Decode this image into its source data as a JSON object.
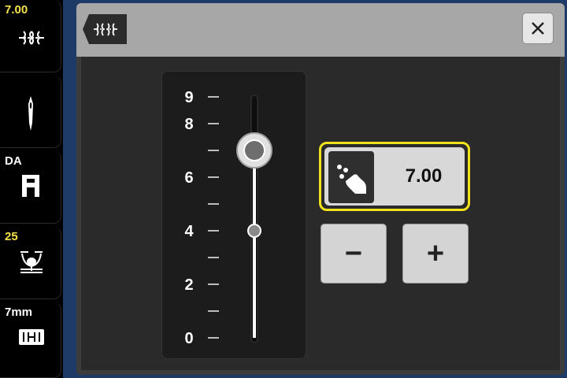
{
  "sidebar": {
    "items": [
      {
        "label": "7.00",
        "icon": "stitch-length-icon",
        "label_color": "#f4e24a"
      },
      {
        "label": "",
        "icon": "needle-icon"
      },
      {
        "label": "DA",
        "icon": "presser-foot-icon",
        "label_color": "#ffffff"
      },
      {
        "label": "25",
        "icon": "foot-pressure-icon",
        "label_color": "#f4e24a"
      },
      {
        "label": "7mm",
        "icon": "stitch-width-icon",
        "label_color": "#ffffff"
      }
    ]
  },
  "header": {
    "tag_icon": "stitch-length-icon",
    "close_icon": "close-icon"
  },
  "slider": {
    "ticks_major": [
      "9",
      "8",
      "6",
      "4",
      "2",
      "0"
    ],
    "min": 0,
    "max": 9,
    "current_value": 7.0,
    "default_value": 4.0
  },
  "value_display": {
    "icon": "touch-hand-icon",
    "value": "7.00"
  },
  "buttons": {
    "minus_label": "−",
    "plus_label": "+"
  },
  "colors": {
    "accent_highlight": "#f2e21c",
    "sidebar_value": "#f4e24a",
    "background": "#1e3a66"
  }
}
